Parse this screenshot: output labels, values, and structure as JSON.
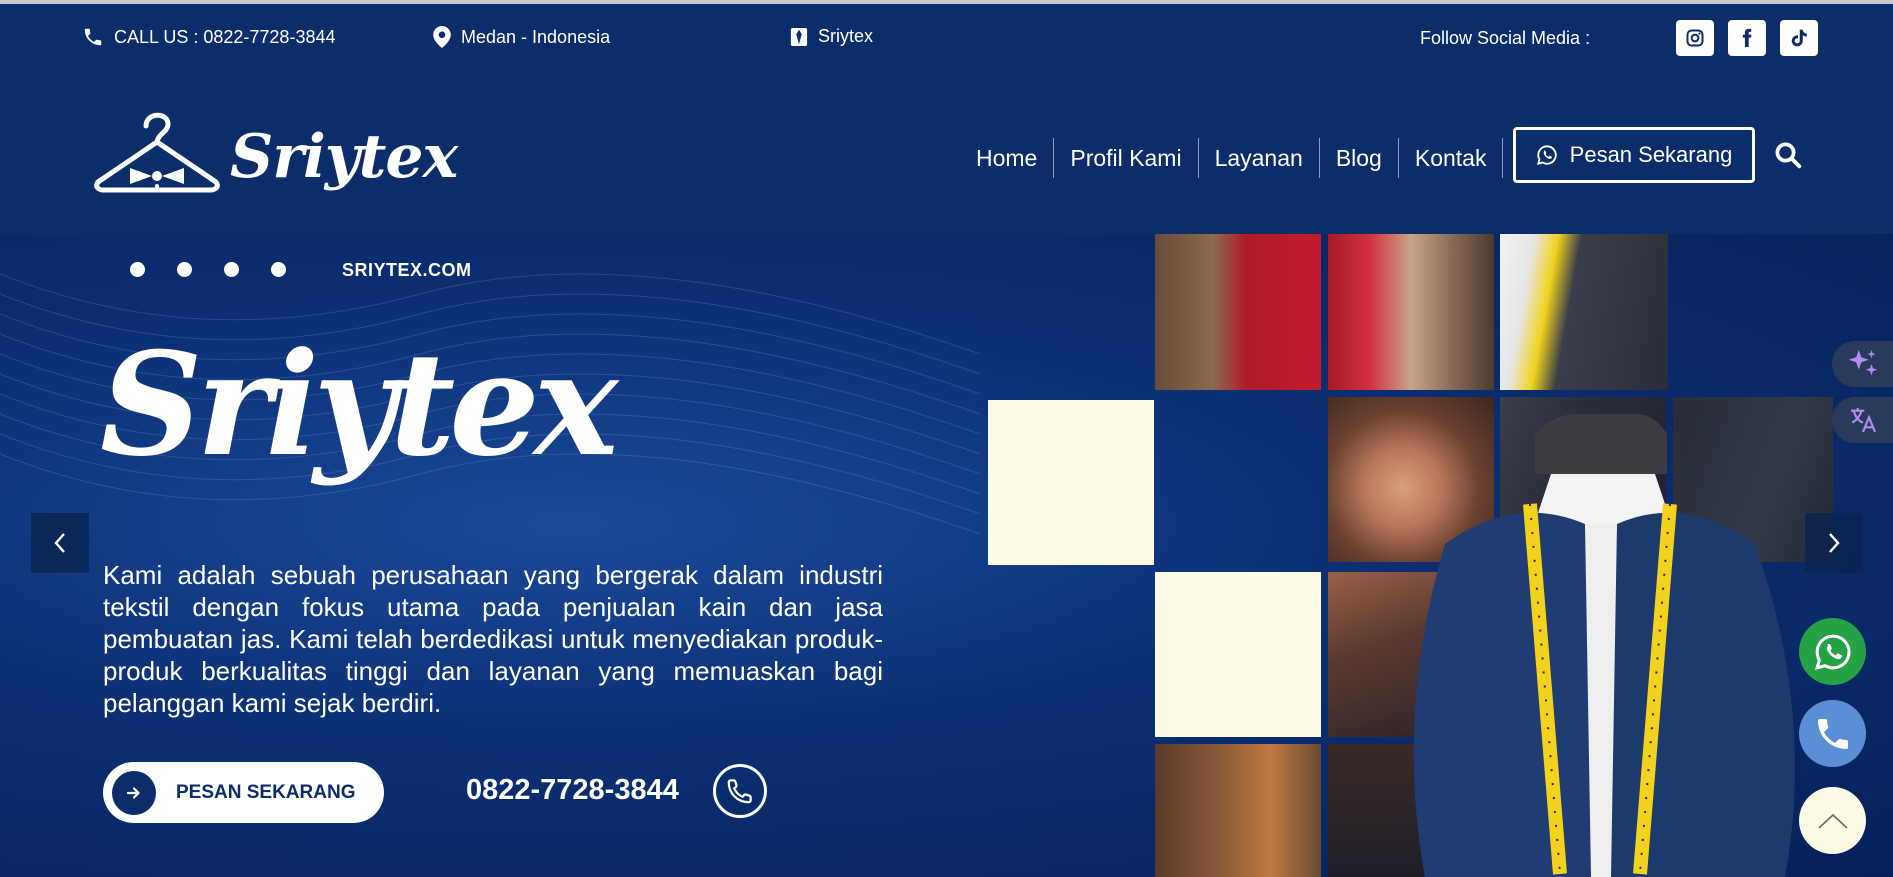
{
  "topbar": {
    "call": "CALL US : 0822-7728-3844",
    "location": "Medan - Indonesia",
    "brand": "Sriytex",
    "follow": "Follow Social Media :",
    "social_icons": [
      "instagram-icon",
      "facebook-icon",
      "tiktok-icon"
    ]
  },
  "header": {
    "logo_text": "Sriytex",
    "nav": [
      "Home",
      "Profil Kami",
      "Layanan",
      "Blog",
      "Kontak"
    ],
    "cta_label": "Pesan Sekarang"
  },
  "hero": {
    "site_label": "SRIYTEX.COM",
    "title": "Sriytex",
    "description": "Kami adalah sebuah perusahaan yang bergerak dalam industri tekstil dengan fokus utama pada penjualan kain dan jasa pembuatan jas. Kami  telah berdedikasi untuk menyediakan produk-produk berkualitas tinggi dan layanan yang memuaskan bagi pelanggan kami sejak berdiri.",
    "cta_label": "PESAN SEKARANG",
    "phone": "0822-7728-3844",
    "slide_dots": 4
  },
  "colors": {
    "primary": "#0b2d6a",
    "cream": "#fdfbe6",
    "whatsapp": "#25a244",
    "phone_widget": "#5a8fd6"
  }
}
